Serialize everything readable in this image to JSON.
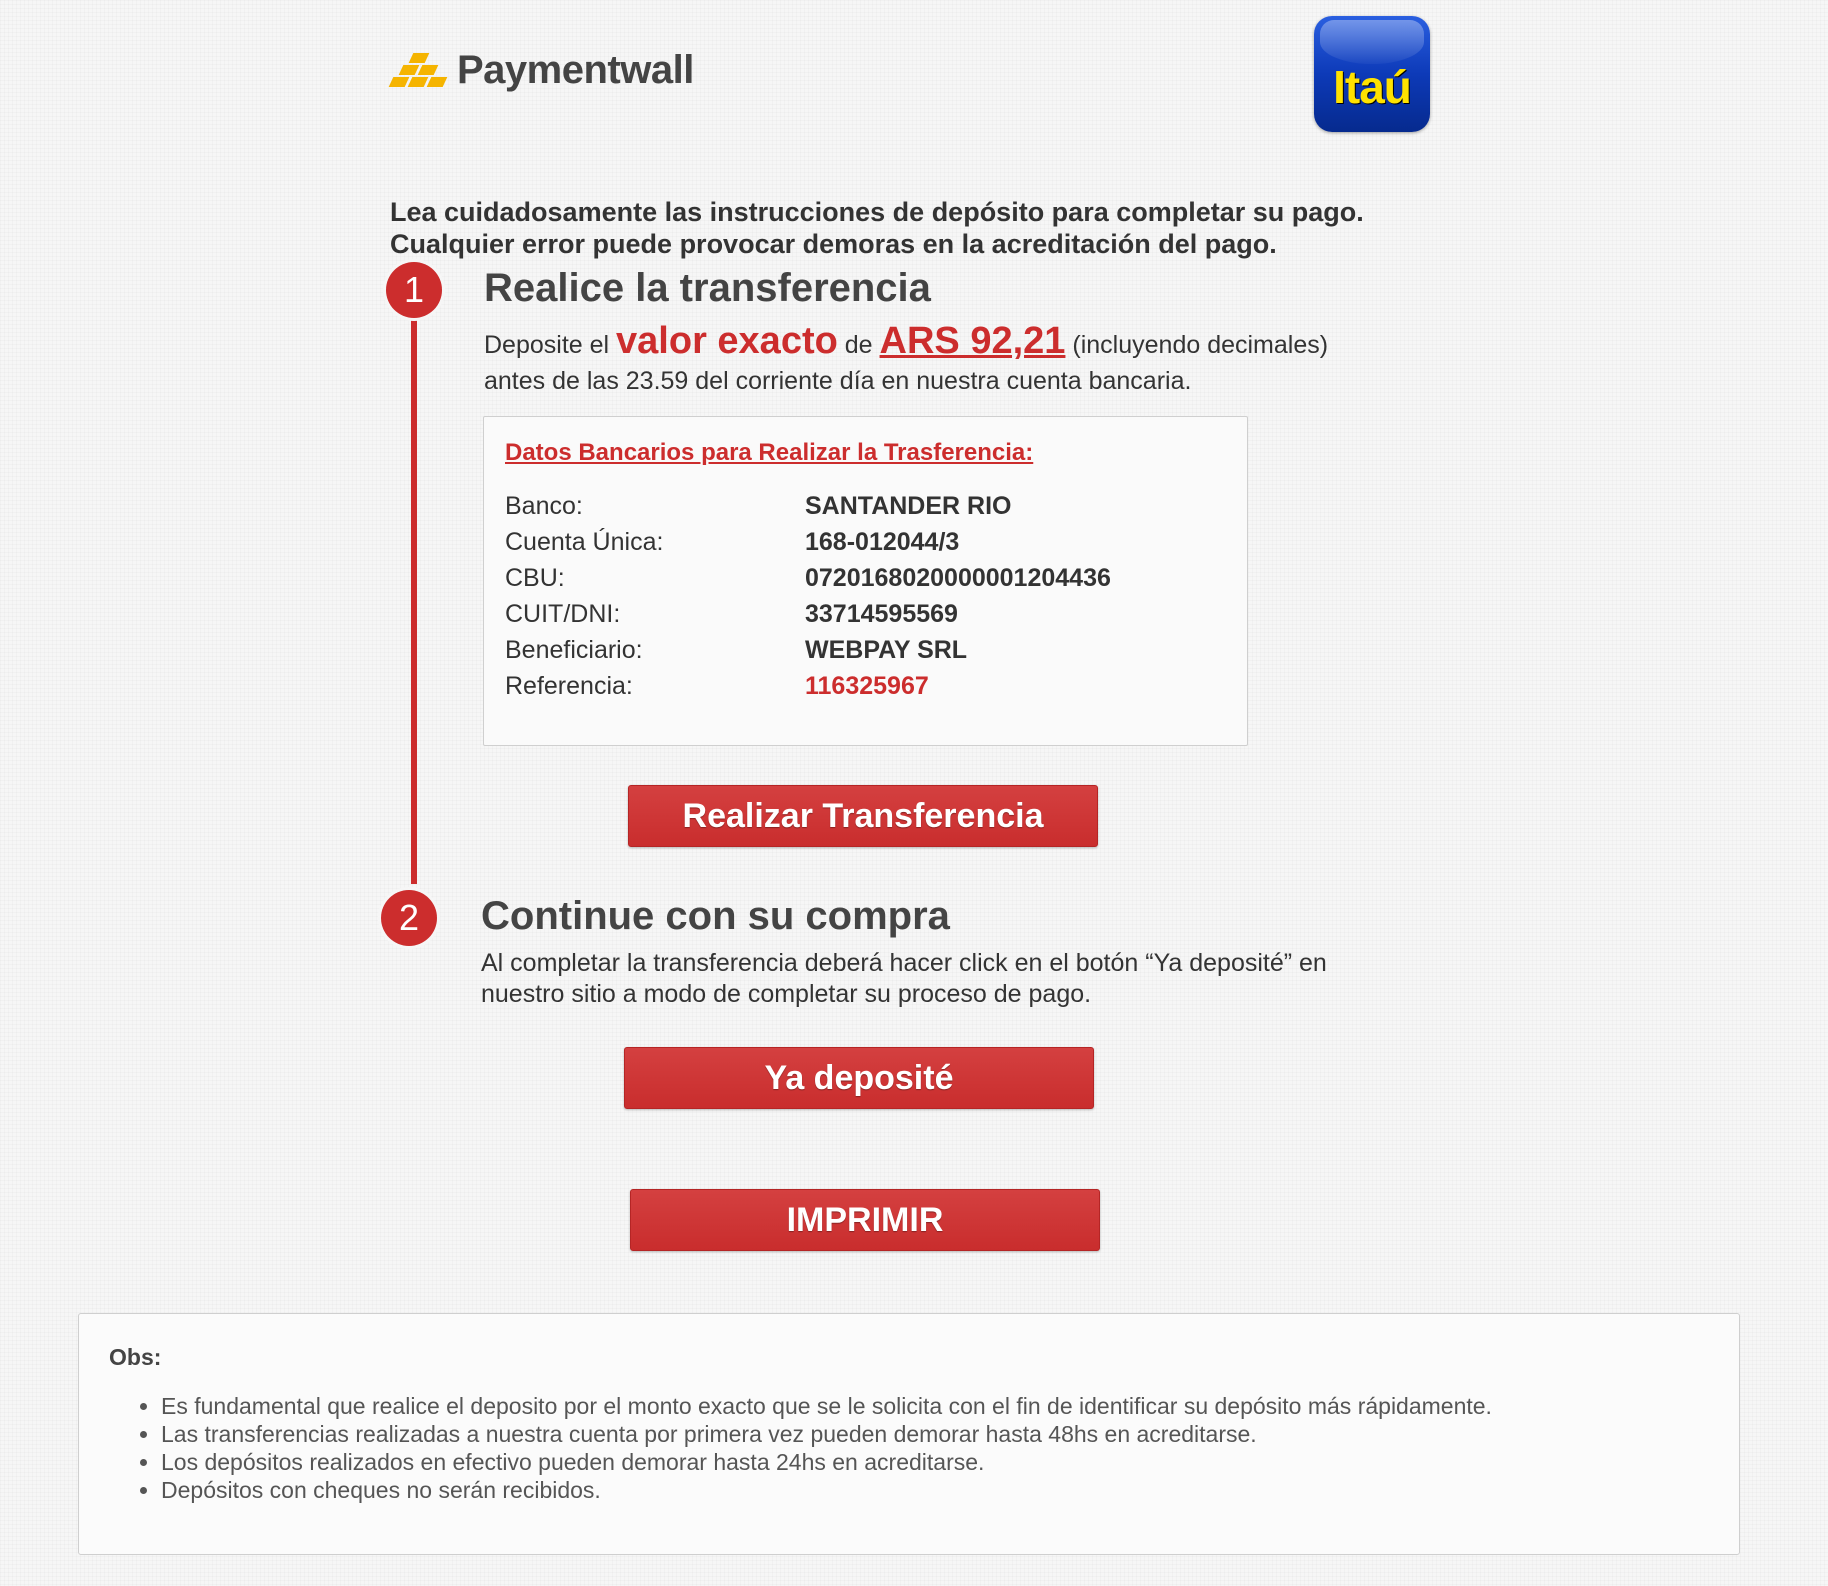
{
  "header": {
    "paymentwall_logo_text": "Paymentwall",
    "bank_logo_text": "Itaú"
  },
  "intro": {
    "line1": "Lea cuidadosamente las instrucciones de depósito para completar su pago.",
    "line2": "Cualquier error puede provocar demoras en la acreditación del pago."
  },
  "step1": {
    "number": "1",
    "title": "Realice la transferencia",
    "text_a": "Deposite el",
    "highlight": "valor exacto",
    "text_b": "de",
    "amount": "ARS 92,21",
    "text_c": "(incluyendo decimales)",
    "line2": "antes de las 23.59 del corriente día en nuestra cuenta bancaria."
  },
  "bank_details": {
    "heading": "Datos Bancarios para Realizar la Trasferencia:",
    "rows": [
      {
        "label": "Banco:",
        "value": "SANTANDER RIO"
      },
      {
        "label": "Cuenta Única:",
        "value": "168-012044/3"
      },
      {
        "label": "CBU:",
        "value": "0720168020000001204436"
      },
      {
        "label": "CUIT/DNI:",
        "value": "33714595569"
      },
      {
        "label": "Beneficiario:",
        "value": "WEBPAY SRL"
      },
      {
        "label": "Referencia:",
        "value": "116325967"
      }
    ]
  },
  "buttons": {
    "transfer": "Realizar Transferencia",
    "deposited": "Ya deposité",
    "print": "IMPRIMIR"
  },
  "step2": {
    "number": "2",
    "title": "Continue con su compra",
    "line1": "Al completar la transferencia deberá hacer click en el botón “Ya deposité” en",
    "line2": "nuestro sitio a modo de completar su proceso de pago."
  },
  "obs": {
    "title": "Obs:",
    "items": [
      "Es fundamental que realice el deposito por el monto exacto que se le solicita con el fin de identificar su depósito más rápidamente.",
      "Las transferencias realizadas a nuestra cuenta por primera vez pueden demorar hasta 48hs en acreditarse.",
      "Los depósitos realizados en efectivo pueden demorar hasta 24hs en acreditarse.",
      "Depósitos con cheques no serán recibidos."
    ]
  },
  "colors": {
    "accent_red": "#cc2d2d",
    "itau_blue": "#0d3ab8",
    "itau_yellow": "#ffe200",
    "paymentwall_gold": "#f5b400"
  },
  "icons": [
    "paymentwall-bars-icon",
    "itau-logo"
  ]
}
